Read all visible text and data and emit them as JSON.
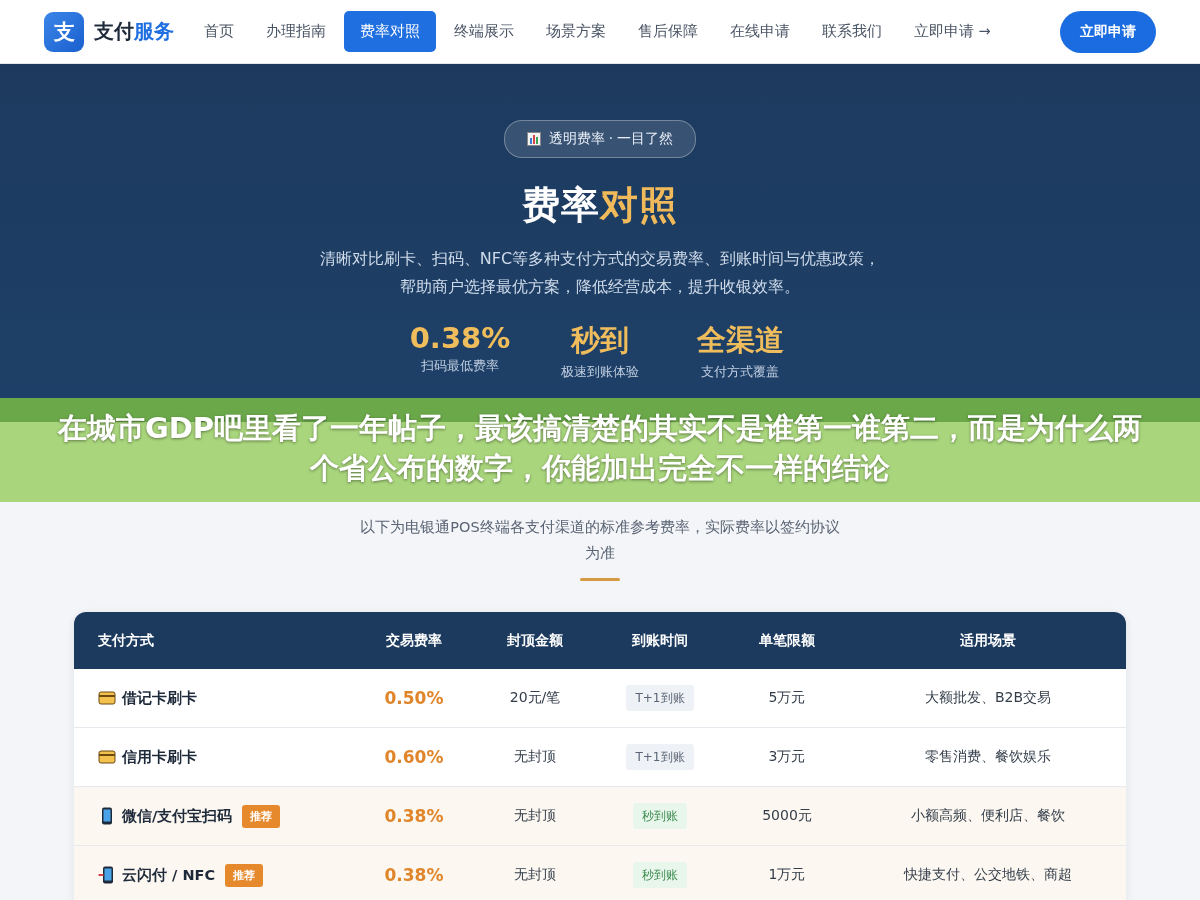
{
  "nav": {
    "logo_mark": "支",
    "logo_main": "支付",
    "logo_accent": "服务",
    "items": [
      {
        "label": "首页",
        "selected": false
      },
      {
        "label": "办理指南",
        "selected": false
      },
      {
        "label": "费率对照",
        "selected": true
      },
      {
        "label": "终端展示",
        "selected": false
      },
      {
        "label": "场景方案",
        "selected": false
      },
      {
        "label": "售后保障",
        "selected": false
      },
      {
        "label": "在线申请",
        "selected": false
      },
      {
        "label": "联系我们",
        "selected": false
      },
      {
        "label": "立即申请 →",
        "selected": false
      }
    ],
    "cta": "立即申请"
  },
  "hero": {
    "pill": "透明费率 · 一目了然",
    "title_main": "费率",
    "title_accent": "对照",
    "description": "清晰对比刷卡、扫码、NFC等多种支付方式的交易费率、到账时间与优惠政策，帮助商户选择最优方案，降低经营成本，提升收银效率。",
    "stats": [
      {
        "value": "0.38%",
        "label": "扫码最低费率"
      },
      {
        "value": "秒到",
        "label": "极速到账体验"
      },
      {
        "value": "全渠道",
        "label": "支付方式覆盖"
      }
    ]
  },
  "banner": {
    "text": "在城市GDP吧里看了一年帖子，最该搞清楚的其实不是谁第一谁第二，而是为什么两个省公布的数字，你能加出完全不一样的结论"
  },
  "section": {
    "subtitle": "以下为电银通POS终端各支付渠道的标准参考费率，实际费率以签约协议为准"
  },
  "table": {
    "columns": [
      "支付方式",
      "交易费率",
      "封顶金额",
      "到账时间",
      "单笔限额",
      "适用场景"
    ],
    "rows": [
      {
        "kind": "card",
        "method": "借记卡刷卡",
        "badge": null,
        "highlighted": false,
        "rate": "0.50%",
        "cap": "20元/笔",
        "settle": {
          "kind": "t1",
          "text": "T+1到账"
        },
        "limit": "5万元",
        "scene": "大额批发、B2B交易"
      },
      {
        "kind": "card",
        "method": "信用卡刷卡",
        "badge": null,
        "highlighted": false,
        "rate": "0.60%",
        "cap": "无封顶",
        "settle": {
          "kind": "t1",
          "text": "T+1到账"
        },
        "limit": "3万元",
        "scene": "零售消费、餐饮娱乐"
      },
      {
        "kind": "phone",
        "method": "微信/支付宝扫码",
        "badge": "推荐",
        "highlighted": true,
        "rate": "0.38%",
        "cap": "无封顶",
        "settle": {
          "kind": "instant",
          "text": "秒到账"
        },
        "limit": "5000元",
        "scene": "小额高频、便利店、餐饮"
      },
      {
        "kind": "nfc",
        "method": "云闪付 / NFC",
        "badge": "推荐",
        "highlighted": true,
        "rate": "0.38%",
        "cap": "无封顶",
        "settle": {
          "kind": "instant",
          "text": "秒到账"
        },
        "limit": "1万元",
        "scene": "快捷支付、公交地铁、商超"
      }
    ]
  }
}
